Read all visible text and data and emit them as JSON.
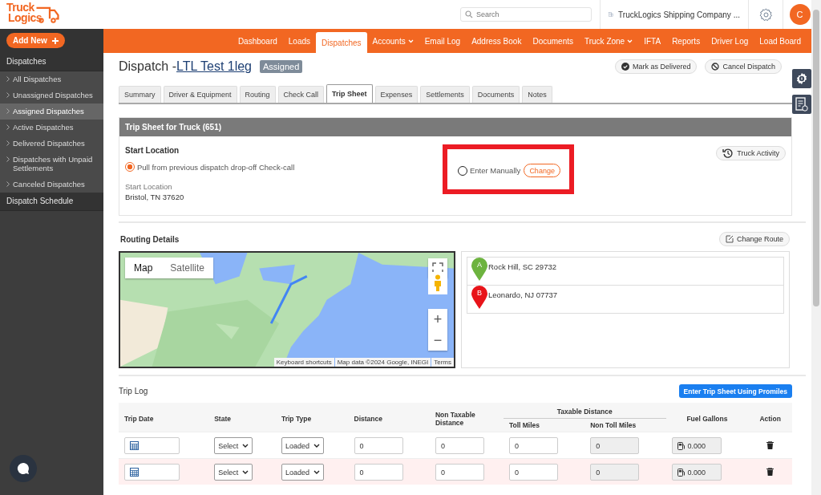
{
  "logo": {
    "line_1": "Truck",
    "line_2": "Logics"
  },
  "header": {
    "search": {
      "placeholder": "Search"
    },
    "company": "TruckLogics Shipping Company ...",
    "avatar": "C"
  },
  "sidebar": {
    "add_new": "Add New",
    "section": "Dispatches",
    "items": [
      {
        "label": "All Dispatches",
        "selected": false
      },
      {
        "label": "Unassigned Dispatches",
        "selected": false
      },
      {
        "label": "Assigned Dispatches",
        "selected": true
      },
      {
        "label": "Active Dispatches",
        "selected": false
      },
      {
        "label": "Delivered Dispatches",
        "selected": false
      },
      {
        "label": "Dispatches with Unpaid Settlements",
        "selected": false
      },
      {
        "label": "Canceled Dispatches",
        "selected": false
      }
    ],
    "footer": "Dispatch Schedule"
  },
  "nav": [
    {
      "label": "Dashboard",
      "selected": false,
      "dropdown": false
    },
    {
      "label": "Loads",
      "selected": false,
      "dropdown": false
    },
    {
      "label": "Dispatches",
      "selected": true,
      "dropdown": false
    },
    {
      "label": "Accounts",
      "selected": false,
      "dropdown": true
    },
    {
      "label": "Email Log",
      "selected": false,
      "dropdown": false
    },
    {
      "label": "Address Book",
      "selected": false,
      "dropdown": false
    },
    {
      "label": "Documents",
      "selected": false,
      "dropdown": false
    },
    {
      "label": "Truck Zone",
      "selected": false,
      "dropdown": true
    },
    {
      "label": "IFTA",
      "selected": false,
      "dropdown": false
    },
    {
      "label": "Reports",
      "selected": false,
      "dropdown": false
    },
    {
      "label": "Driver Log",
      "selected": false,
      "dropdown": false
    },
    {
      "label": "Load Board",
      "selected": false,
      "dropdown": false
    }
  ],
  "page": {
    "title_prefix": "Dispatch - ",
    "title_link": "LTL Test 1leg",
    "status": "Assigned",
    "actions": [
      "Mark as Delivered",
      "Cancel Dispatch"
    ]
  },
  "tabs": [
    {
      "label": "Summary",
      "selected": false
    },
    {
      "label": "Driver & Equipment",
      "selected": false
    },
    {
      "label": "Routing",
      "selected": false
    },
    {
      "label": "Check Call",
      "selected": false
    },
    {
      "label": "Trip Sheet",
      "selected": true
    },
    {
      "label": "Expenses",
      "selected": false
    },
    {
      "label": "Settlements",
      "selected": false
    },
    {
      "label": "Documents",
      "selected": false
    },
    {
      "label": "Notes",
      "selected": false
    }
  ],
  "trip_sheet": {
    "title": "Trip Sheet for Truck (651)",
    "start_heading": "Start Location",
    "options": [
      {
        "label": "Pull from previous dispatch drop-off Check-call",
        "selected": true
      },
      {
        "label": "Enter Manually",
        "selected": false,
        "button": "Change"
      }
    ],
    "start_label": "Start Location",
    "start_value": "Bristol, TN 37620",
    "truck_activity": "Truck Activity"
  },
  "routing": {
    "title": "Routing Details",
    "change_route": "Change Route",
    "map": {
      "kind": "picture",
      "types": [
        {
          "label": "Map",
          "selected": true
        },
        {
          "label": "Satellite",
          "selected": false
        }
      ],
      "zoom_in": "+",
      "zoom_out": "−",
      "footer": [
        "Keyboard shortcuts",
        "Map data ©2024 Google, INEGI",
        "Terms"
      ]
    },
    "stops": [
      {
        "marker": "A",
        "address": "Rock Hill, SC 29732",
        "color": "#6db33f"
      },
      {
        "marker": "B",
        "address": "Leonardo, NJ 07737",
        "color": "#e8141a"
      }
    ]
  },
  "trip_log": {
    "title": "Trip Log",
    "promiles": "Enter Trip Sheet Using Promiles",
    "columns": [
      "Trip Date",
      "State",
      "Trip Type",
      "Distance",
      "Non Taxable Distance",
      "Taxable Distance",
      "Toll Miles",
      "Non Toll Miles",
      "Fuel Gallons",
      "Action"
    ],
    "rows": [
      {
        "state": "Select",
        "trip_type": "Loaded",
        "distance": "0",
        "non_taxable": "0",
        "toll": "0",
        "non_toll": "0",
        "fuel": "0.000",
        "highlighted": false
      },
      {
        "state": "Select",
        "trip_type": "Loaded",
        "distance": "0",
        "non_taxable": "0",
        "toll": "0",
        "non_toll": "0",
        "fuel": "0.000",
        "highlighted": true
      }
    ]
  }
}
